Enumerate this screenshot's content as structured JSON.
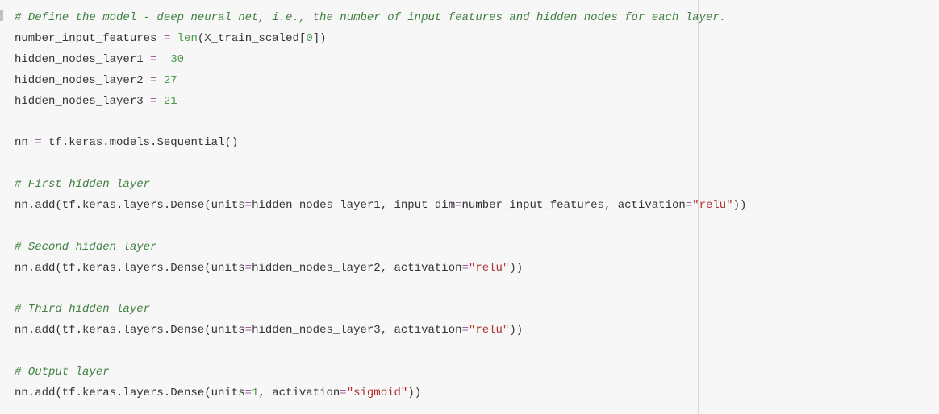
{
  "code": {
    "comment_define": "# Define the model - deep neural net, i.e., the number of input features and hidden nodes for each layer.",
    "l2_var": "number_input_features",
    "l2_eq": " = ",
    "l2_func": "len",
    "l2_open": "(",
    "l2_arg": "X_train_scaled",
    "l2_br_open": "[",
    "l2_idx": "0",
    "l2_br_close": "]",
    "l2_close": ")",
    "l3_var": "hidden_nodes_layer1",
    "l3_eq": " =  ",
    "l3_val": "30",
    "l4_var": "hidden_nodes_layer2",
    "l4_eq": " = ",
    "l4_val": "27",
    "l5_var": "hidden_nodes_layer3",
    "l5_eq": " = ",
    "l5_val": "21",
    "l7_var": "nn",
    "l7_eq": " = ",
    "l7_mod": "tf.keras.models.Sequential",
    "l7_open": "(",
    "l7_close": ")",
    "comment_first": "# First hidden layer",
    "l10_pre": "nn.add(tf.keras.layers.Dense(units",
    "l10_eq1": "=",
    "l10_arg1": "hidden_nodes_layer1, input_dim",
    "l10_eq2": "=",
    "l10_arg2": "number_input_features, activation",
    "l10_eq3": "=",
    "l10_str": "\"relu\"",
    "l10_close": "))",
    "comment_second": "# Second hidden layer",
    "l13_pre": "nn.add(tf.keras.layers.Dense(units",
    "l13_eq1": "=",
    "l13_arg1": "hidden_nodes_layer2, activation",
    "l13_eq2": "=",
    "l13_str": "\"relu\"",
    "l13_close": "))",
    "comment_third": "# Third hidden layer",
    "l16_pre": "nn.add(tf.keras.layers.Dense(units",
    "l16_eq1": "=",
    "l16_arg1": "hidden_nodes_layer3, activation",
    "l16_eq2": "=",
    "l16_str": "\"relu\"",
    "l16_close": "))",
    "comment_output": "# Output layer",
    "l19_pre": "nn.add(tf.keras.layers.Dense(units",
    "l19_eq1": "=",
    "l19_val": "1",
    "l19_arg1": ", activation",
    "l19_eq2": "=",
    "l19_str": "\"sigmoid\"",
    "l19_close": "))"
  }
}
